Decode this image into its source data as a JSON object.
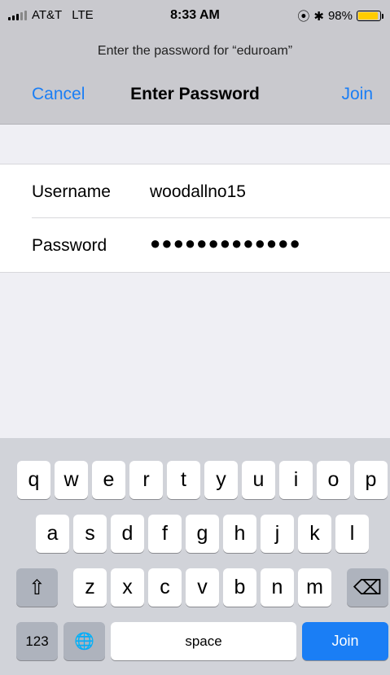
{
  "status": {
    "carrier": "AT&T",
    "network": "LTE",
    "time": "8:33 AM",
    "lock_symbol": "⦿",
    "bt_symbol": "✱",
    "battery_percent": "98%",
    "battery_level": 0.98,
    "battery_color": "#ffcc00"
  },
  "header": {
    "prompt": "Enter the password for “eduroam”",
    "cancel_label": "Cancel",
    "title": "Enter Password",
    "join_label": "Join",
    "accent_color": "#1a7ef5"
  },
  "form": {
    "username_label": "Username",
    "username_value": "woodallno15",
    "password_label": "Password",
    "password_value": "●●●●●●●●●●●●●"
  },
  "keyboard": {
    "row1": [
      "q",
      "w",
      "e",
      "r",
      "t",
      "y",
      "u",
      "i",
      "o",
      "p"
    ],
    "row2": [
      "a",
      "s",
      "d",
      "f",
      "g",
      "h",
      "j",
      "k",
      "l"
    ],
    "row3": [
      "z",
      "x",
      "c",
      "v",
      "b",
      "n",
      "m"
    ],
    "shift_symbol": "⇧",
    "backspace_symbol": "⌫",
    "numbers_label": "123",
    "globe_symbol": "🌐",
    "space_label": "space",
    "join_label": "Join"
  }
}
